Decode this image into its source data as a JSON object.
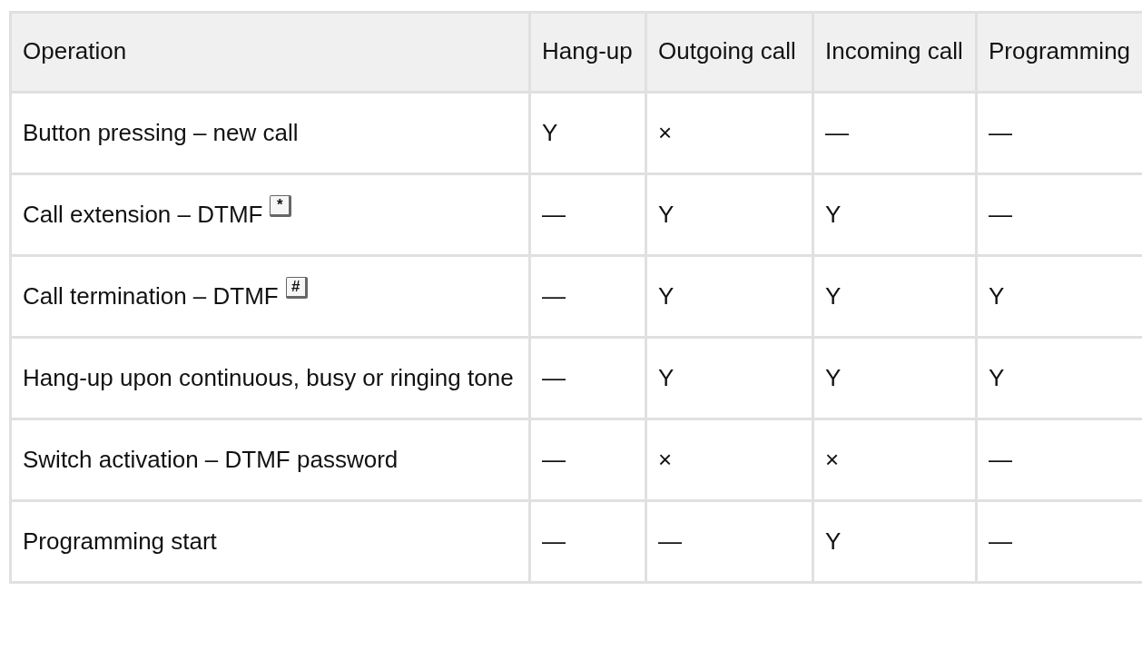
{
  "table": {
    "columns": [
      "Operation",
      "Hang-up",
      "Outgoing call",
      "Incoming call",
      "Programming"
    ],
    "rows": [
      {
        "cells": [
          "Button pressing – new call",
          "Y",
          "×",
          "—",
          "—"
        ]
      },
      {
        "cells": [
          "Call extension – DTMF",
          "—",
          "Y",
          "Y",
          "—"
        ],
        "key": "*"
      },
      {
        "cells": [
          "Call termination – DTMF",
          "—",
          "Y",
          "Y",
          "Y"
        ],
        "key": "#"
      },
      {
        "cells": [
          "Hang-up upon continuous, busy or ringing tone",
          "—",
          "Y",
          "Y",
          "Y"
        ]
      },
      {
        "cells": [
          "Switch activation – DTMF password",
          "—",
          "×",
          "×",
          "—"
        ]
      },
      {
        "cells": [
          "Programming start",
          "—",
          "—",
          "Y",
          "—"
        ]
      }
    ]
  }
}
